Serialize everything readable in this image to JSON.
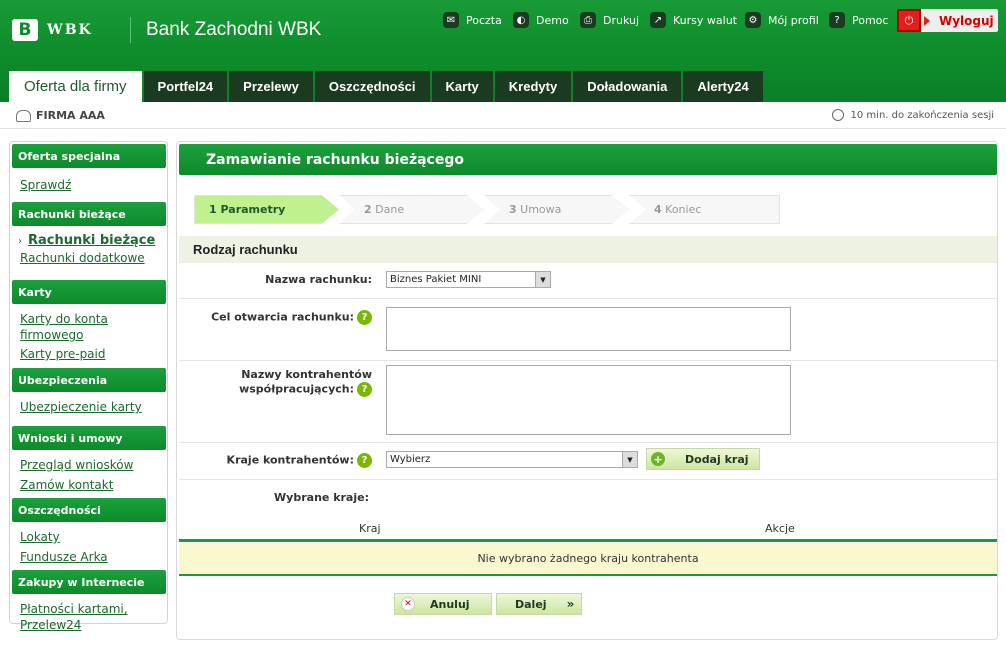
{
  "header": {
    "logo_mark": "B",
    "logo_text": "WBK",
    "bank_name": "Bank Zachodni WBK",
    "top_links": [
      {
        "label": "Poczta",
        "icon": "mail-icon"
      },
      {
        "label": "Demo",
        "icon": "demo-icon"
      },
      {
        "label": "Drukuj",
        "icon": "print-icon"
      },
      {
        "label": "Kursy walut",
        "icon": "chart-icon"
      },
      {
        "label": "Mój profil",
        "icon": "gear-icon"
      },
      {
        "label": "Pomoc",
        "icon": "help-icon"
      }
    ],
    "logout_label": "Wyloguj"
  },
  "tabs": [
    {
      "label": "Oferta dla firmy",
      "active": true
    },
    {
      "label": "Portfel24"
    },
    {
      "label": "Przelewy"
    },
    {
      "label": "Oszczędności"
    },
    {
      "label": "Karty"
    },
    {
      "label": "Kredyty"
    },
    {
      "label": "Doładowania"
    },
    {
      "label": "Alerty24"
    }
  ],
  "subbar": {
    "company": "FIRMA AAA",
    "session": "10 min. do zakończenia sesji"
  },
  "sidebar": {
    "sections": [
      {
        "title": "Oferta specjalna",
        "links": [
          "Sprawdź"
        ]
      },
      {
        "title": "Rachunki bieżące",
        "links": [
          "Rachunki bieżące",
          "Rachunki dodatkowe"
        ]
      },
      {
        "title": "Karty",
        "links": [
          "Karty do konta firmowego",
          "Karty pre-paid"
        ]
      },
      {
        "title": "Ubezpieczenia",
        "links": [
          "Ubezpieczenie karty"
        ]
      },
      {
        "title": "Wnioski i umowy",
        "links": [
          "Przegląd wniosków",
          "Zamów kontakt"
        ]
      },
      {
        "title": "Oszczędności",
        "links": [
          "Lokaty",
          "Fundusze Arka"
        ]
      },
      {
        "title": "Zakupy w Internecie",
        "links": [
          "Płatności kartami, Przelew24"
        ]
      }
    ],
    "active_link": "Rachunki bieżące"
  },
  "main": {
    "title": "Zamawianie rachunku bieżącego",
    "steps": [
      {
        "num": "1",
        "label": "Parametry"
      },
      {
        "num": "2",
        "label": "Dane"
      },
      {
        "num": "3",
        "label": "Umowa"
      },
      {
        "num": "4",
        "label": "Koniec"
      }
    ],
    "section_title": "Rodzaj rachunku",
    "account_name_label": "Nazwa rachunku:",
    "account_name_value": "Biznes Pakiet MINI",
    "purpose_label": "Cel otwarcia rachunku:",
    "contractors_label_1": "Nazwy kontrahentów",
    "contractors_label_2": "współpracujących:",
    "countries_label": "Kraje kontrahentów:",
    "countries_select": "Wybierz",
    "add_country_label": "Dodaj kraj",
    "selected_countries_label": "Wybrane kraje:",
    "table": {
      "col_country": "Kraj",
      "col_actions": "Akcje",
      "empty": "Nie wybrano żadnego kraju kontrahenta"
    },
    "cancel_label": "Anuluj",
    "next_label": "Dalej",
    "help_glyph": "?"
  }
}
